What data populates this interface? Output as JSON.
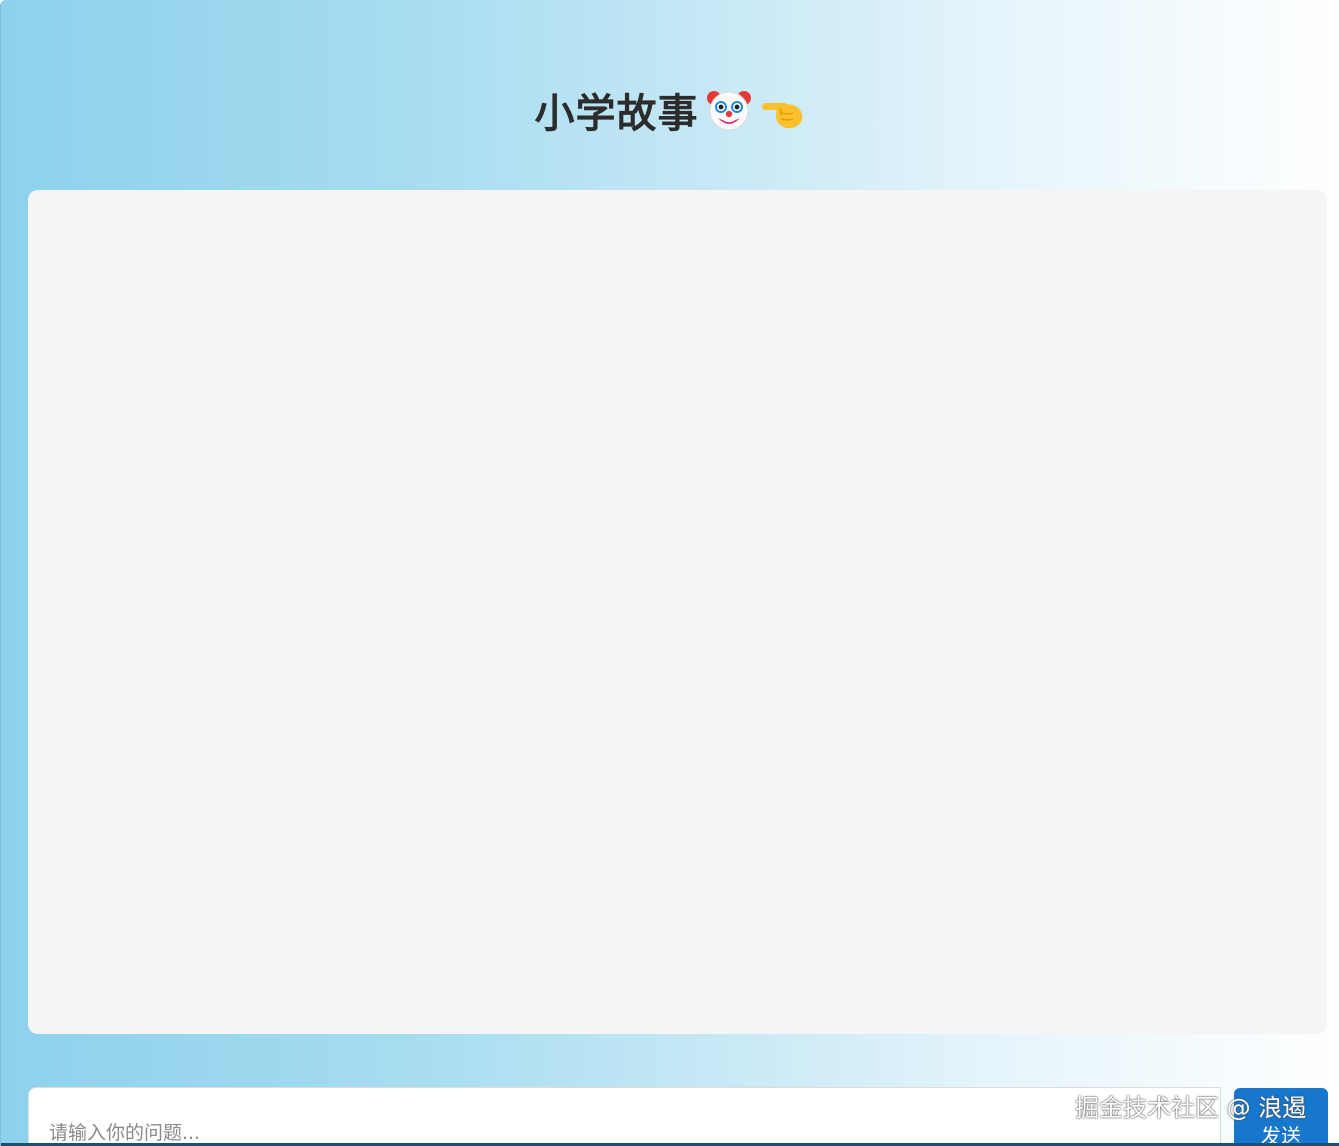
{
  "header": {
    "title": "小学故事",
    "title_icons": [
      "clown-face-icon",
      "pointing-hand-icon"
    ]
  },
  "chat": {
    "messages": []
  },
  "composer": {
    "placeholder": "请输入你的问题...",
    "value": "",
    "send_label": "发送"
  },
  "watermark": {
    "text": "掘金技术社区 @ 浪遏"
  },
  "colors": {
    "gradient_left": "#8ed1ec",
    "gradient_right": "#ffffff",
    "panel_bg": "#f5f5f5",
    "send_button": "#1677cc",
    "title_text": "#2c2c2c"
  }
}
